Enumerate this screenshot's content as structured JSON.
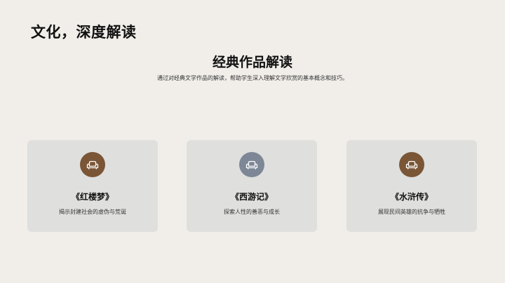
{
  "header": {
    "title": "文化，深度解读"
  },
  "section": {
    "heading": "经典作品解读",
    "description": "通过对经典文学作品的解读，帮助学生深入理解文学欣赏的基本概念和技巧。"
  },
  "cards": [
    {
      "title": "《红楼梦》",
      "description": "揭示封建社会的虚伪与荒诞",
      "icon": "armchair-icon",
      "color": "#7a5637"
    },
    {
      "title": "《西游记》",
      "description": "探索人性的善恶与成长",
      "icon": "armchair-icon",
      "color": "#7d8796"
    },
    {
      "title": "《水浒传》",
      "description": "展现民间英雄的抗争与牺牲",
      "icon": "armchair-icon",
      "color": "#7a5637"
    }
  ]
}
